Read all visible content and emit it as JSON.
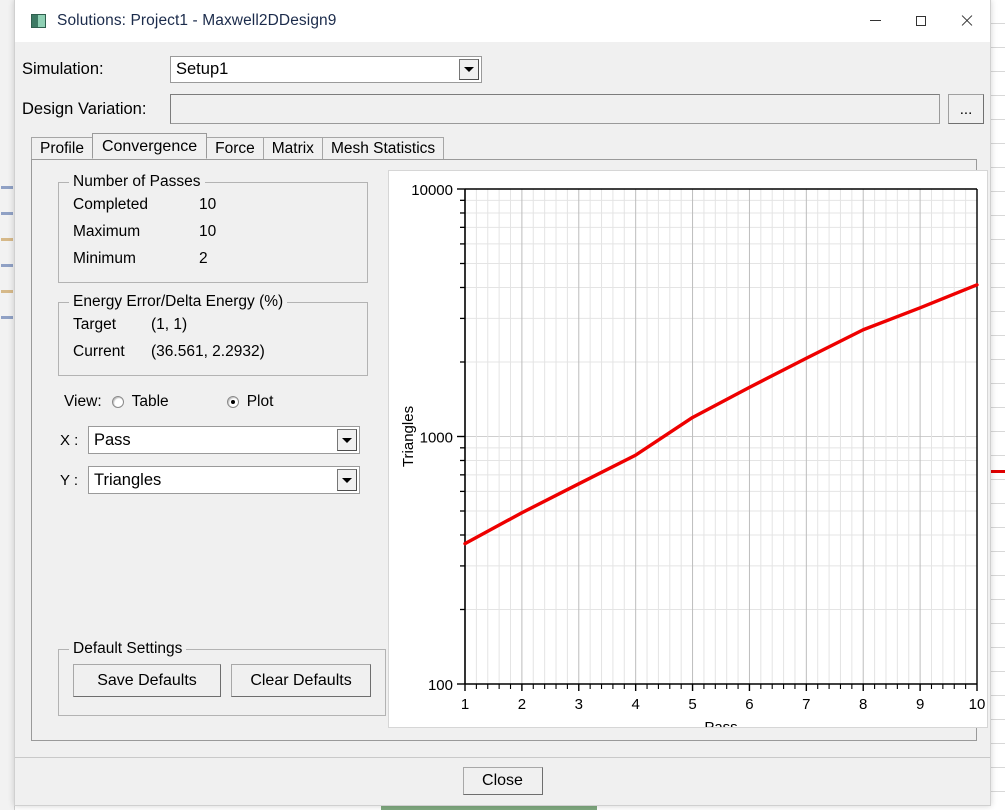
{
  "window": {
    "title": "Solutions: Project1 - Maxwell2DDesign9",
    "icon": "application-icon",
    "controls": {
      "minimize": "minimize-icon",
      "maximize": "maximize-icon",
      "close": "close-icon"
    }
  },
  "form": {
    "simulation_label": "Simulation:",
    "simulation_value": "Setup1",
    "design_variation_label": "Design Variation:",
    "design_variation_value": "",
    "ellipsis_label": "..."
  },
  "tabs": [
    {
      "label": "Profile",
      "active": false
    },
    {
      "label": "Convergence",
      "active": true
    },
    {
      "label": "Force",
      "active": false
    },
    {
      "label": "Matrix",
      "active": false
    },
    {
      "label": "Mesh Statistics",
      "active": false
    }
  ],
  "passes": {
    "legend": "Number of Passes",
    "rows": [
      {
        "key": "Completed",
        "value": "10"
      },
      {
        "key": "Maximum",
        "value": "10"
      },
      {
        "key": "Minimum",
        "value": "2"
      }
    ]
  },
  "energy": {
    "legend": "Energy Error/Delta Energy (%)",
    "rows": [
      {
        "key": "Target",
        "value": "(1, 1)"
      },
      {
        "key": "Current",
        "value": "(36.561, 2.2932)"
      }
    ]
  },
  "view": {
    "label": "View:",
    "options": [
      {
        "label": "Table",
        "selected": false
      },
      {
        "label": "Plot",
        "selected": true
      }
    ],
    "x_label": "X :",
    "x_value": "Pass",
    "y_label": "Y :",
    "y_value": "Triangles"
  },
  "defaults": {
    "legend": "Default Settings",
    "save_label": "Save Defaults",
    "clear_label": "Clear Defaults"
  },
  "footer": {
    "close_label": "Close"
  },
  "chart_data": {
    "type": "line",
    "title": "",
    "xlabel": "Pass",
    "ylabel": "Triangles",
    "yscale": "log",
    "xlim": [
      1,
      10
    ],
    "ylim": [
      100,
      10000
    ],
    "ytick_labels": [
      "100",
      "1000",
      "10000"
    ],
    "ytick_values": [
      100,
      1000,
      10000
    ],
    "xtick_labels": [
      "1",
      "2",
      "3",
      "4",
      "5",
      "6",
      "7",
      "8",
      "9",
      "10"
    ],
    "xtick_values": [
      1,
      2,
      3,
      4,
      5,
      6,
      7,
      8,
      9,
      10
    ],
    "grid": true,
    "legend_position": "none",
    "series": [
      {
        "name": "Triangles",
        "color": "#ee0000",
        "x": [
          1,
          2,
          3,
          4,
          5,
          6,
          7,
          8,
          9,
          10
        ],
        "values": [
          369,
          492,
          644,
          841,
          1194,
          1580,
          2070,
          2700,
          3310,
          4100
        ]
      }
    ]
  }
}
